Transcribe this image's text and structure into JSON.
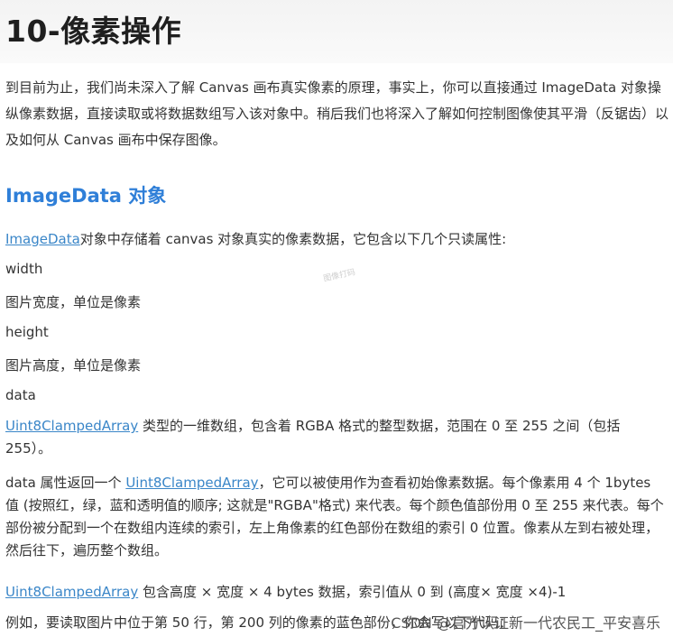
{
  "title": "10-像素操作",
  "intro": "到目前为止，我们尚未深入了解 Canvas 画布真实像素的原理，事实上，你可以直接通过 ImageData 对象操纵像素数据，直接读取或将数据数组写入该对象中。稍后我们也将深入了解如何控制图像使其平滑（反锯齿）以及如何从 Canvas 画布中保存图像。",
  "section_heading": "ImageData 对象",
  "imagedata_link": "ImageData",
  "imagedata_desc": "对象中存储着 canvas 对象真实的像素数据，它包含以下几个只读属性:",
  "props": {
    "width_name": "width",
    "width_desc": "图片宽度，单位是像素",
    "height_name": "height",
    "height_desc": "图片高度，单位是像素",
    "data_name": "data"
  },
  "data_type_link": "Uint8ClampedArray",
  "data_type_desc": " 类型的一维数组，包含着 RGBA 格式的整型数据，范围在 0 至 255 之间（包括 255）。",
  "data_attr_prefix": "data 属性返回一个 ",
  "data_attr_link": "Uint8ClampedArray",
  "data_attr_desc": "，它可以被使用作为查看初始像素数据。每个像素用 4 个 1bytes 值 (按照红，绿，蓝和透明值的顺序; 这就是\"RGBA\"格式) 来代表。每个颜色值部份用 0 至 255 来代表。每个部份被分配到一个在数组内连续的索引，左上角像素的红色部份在数组的索引 0 位置。像素从左到右被处理，然后往下，遍历整个数组。",
  "size_link": "Uint8ClampedArray",
  "size_desc": " 包含高度 × 宽度 × 4 bytes 数据，索引值从 0 到 (高度× 宽度 ×4)-1",
  "example_text": "例如，要读取图片中位于第 50 行，第 200 列的像素的蓝色部份，你会写以下代码：",
  "watermark_small": "图像打码",
  "footer_watermark": "CSDN @官方认证新一代农民工_平安喜乐"
}
